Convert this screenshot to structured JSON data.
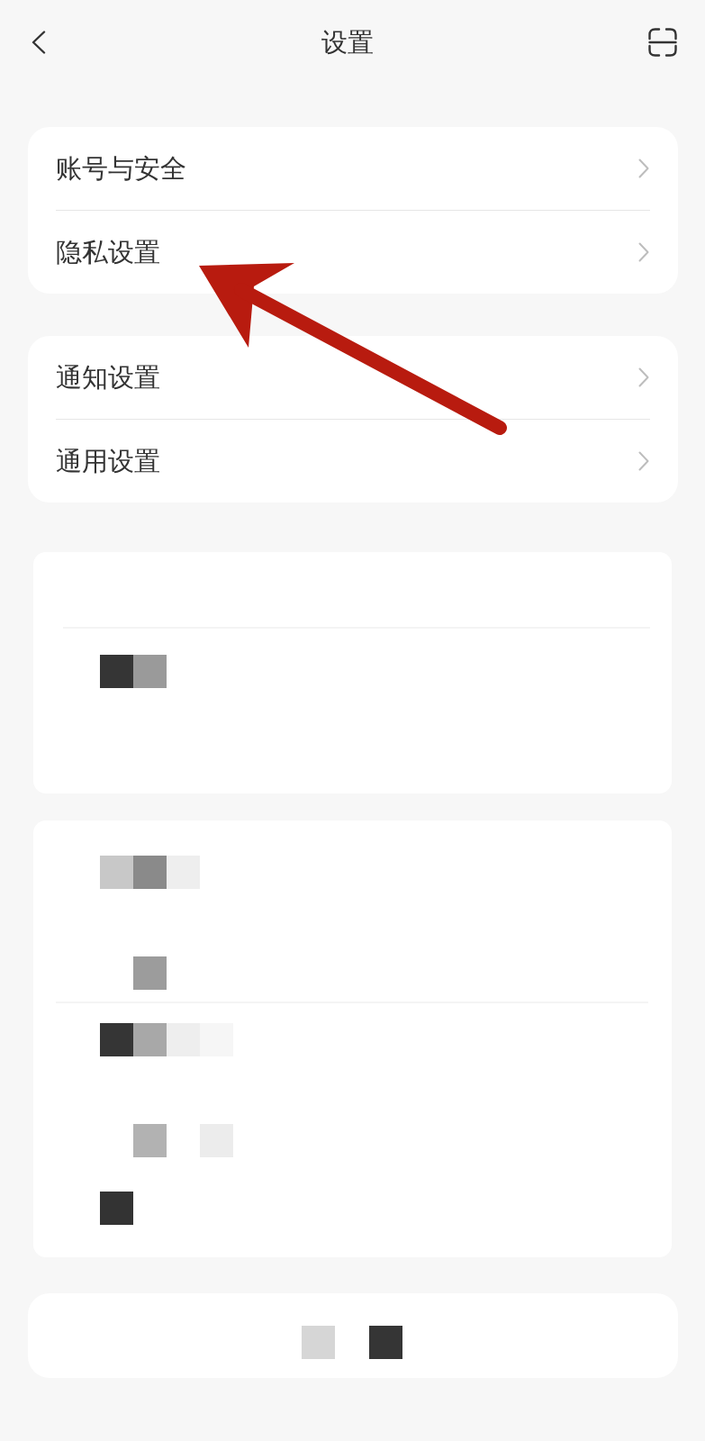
{
  "header": {
    "title": "设置"
  },
  "sections": [
    {
      "kind": "menu",
      "items": [
        {
          "label": "账号与安全"
        },
        {
          "label": "隐私设置"
        }
      ]
    },
    {
      "kind": "menu",
      "items": [
        {
          "label": "通知设置"
        },
        {
          "label": "通用设置"
        }
      ]
    },
    {
      "kind": "redacted"
    },
    {
      "kind": "redacted"
    },
    {
      "kind": "redacted"
    }
  ],
  "annotation": {
    "kind": "arrow"
  }
}
